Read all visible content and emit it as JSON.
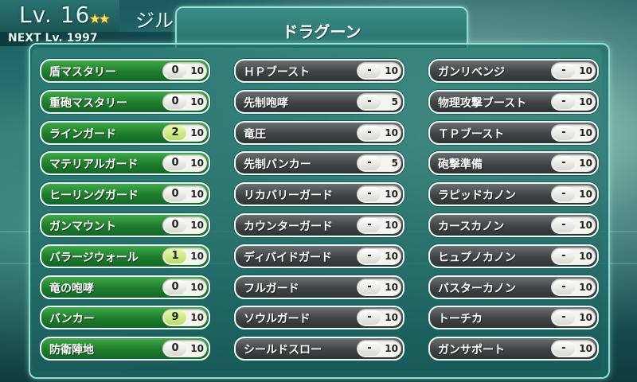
{
  "header": {
    "level_label": "Lv. 16",
    "character_name": "ジル",
    "next_label": "NEXT Lv. 1997"
  },
  "panel": {
    "title": "ドラグーン"
  },
  "skills": [
    [
      {
        "name": "盾マスタリー",
        "current": "0",
        "max": "10",
        "state": "learnable"
      },
      {
        "name": "重砲マスタリー",
        "current": "0",
        "max": "10",
        "state": "learnable"
      },
      {
        "name": "ラインガード",
        "current": "2",
        "max": "10",
        "state": "learnable"
      },
      {
        "name": "マテリアルガード",
        "current": "0",
        "max": "10",
        "state": "learnable"
      },
      {
        "name": "ヒーリングガード",
        "current": "0",
        "max": "10",
        "state": "learnable"
      },
      {
        "name": "ガンマウント",
        "current": "0",
        "max": "10",
        "state": "learnable"
      },
      {
        "name": "バラージウォール",
        "current": "1",
        "max": "10",
        "state": "learnable"
      },
      {
        "name": "竜の咆哮",
        "current": "0",
        "max": "10",
        "state": "learnable"
      },
      {
        "name": "バンカー",
        "current": "9",
        "max": "10",
        "state": "learnable"
      },
      {
        "name": "防衛陣地",
        "current": "0",
        "max": "10",
        "state": "learnable"
      }
    ],
    [
      {
        "name": "ＨＰブースト",
        "current": "-",
        "max": "10",
        "state": "locked"
      },
      {
        "name": "先制咆哮",
        "current": "-",
        "max": "5",
        "state": "locked"
      },
      {
        "name": "竜圧",
        "current": "-",
        "max": "10",
        "state": "locked"
      },
      {
        "name": "先制バンカー",
        "current": "-",
        "max": "5",
        "state": "locked"
      },
      {
        "name": "リカバリーガード",
        "current": "-",
        "max": "10",
        "state": "locked"
      },
      {
        "name": "カウンターガード",
        "current": "-",
        "max": "10",
        "state": "locked"
      },
      {
        "name": "ディバイドガード",
        "current": "-",
        "max": "10",
        "state": "locked"
      },
      {
        "name": "フルガード",
        "current": "-",
        "max": "10",
        "state": "locked"
      },
      {
        "name": "ソウルガード",
        "current": "-",
        "max": "10",
        "state": "locked"
      },
      {
        "name": "シールドスロー",
        "current": "-",
        "max": "10",
        "state": "locked"
      }
    ],
    [
      {
        "name": "ガンリベンジ",
        "current": "-",
        "max": "10",
        "state": "locked"
      },
      {
        "name": "物理攻撃ブースト",
        "current": "-",
        "max": "10",
        "state": "locked"
      },
      {
        "name": "ＴＰブースト",
        "current": "-",
        "max": "10",
        "state": "locked"
      },
      {
        "name": "砲撃準備",
        "current": "-",
        "max": "10",
        "state": "locked"
      },
      {
        "name": "ラピッドカノン",
        "current": "-",
        "max": "10",
        "state": "locked"
      },
      {
        "name": "カースカノン",
        "current": "-",
        "max": "10",
        "state": "locked"
      },
      {
        "name": "ヒュプノカノン",
        "current": "-",
        "max": "10",
        "state": "locked"
      },
      {
        "name": "バスターカノン",
        "current": "-",
        "max": "10",
        "state": "locked"
      },
      {
        "name": "トーチカ",
        "current": "-",
        "max": "10",
        "state": "locked"
      },
      {
        "name": "ガンサポート",
        "current": "-",
        "max": "10",
        "state": "locked"
      }
    ]
  ],
  "colors": {
    "learnable": "#1f7c2c",
    "locked": "#3f4446",
    "panel_border": "#8fe0d0"
  }
}
